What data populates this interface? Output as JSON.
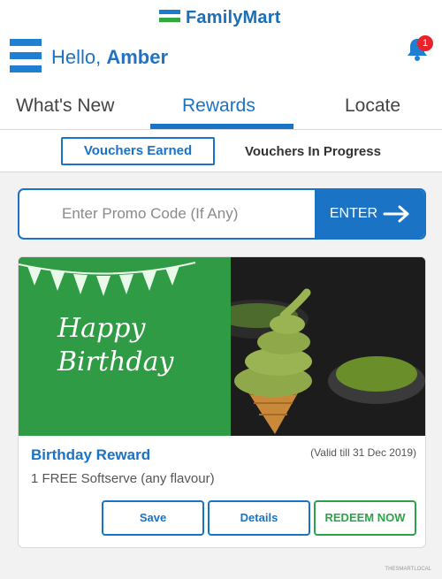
{
  "app": {
    "brand": "FamilyMart",
    "greeting_prefix": "Hello, ",
    "user_name": "Amber",
    "notification_count": "1"
  },
  "tabs": [
    {
      "label": "What's New"
    },
    {
      "label": "Rewards"
    },
    {
      "label": "Locate"
    }
  ],
  "subtabs": {
    "earned": "Vouchers Earned",
    "in_progress": "Vouchers In Progress"
  },
  "promo": {
    "placeholder": "Enter Promo Code (If Any)",
    "button_label": "ENTER"
  },
  "voucher": {
    "banner_line1": "Happy",
    "banner_line2": "Birthday",
    "title": "Birthday Reward",
    "validity": "(Valid till 31 Dec 2019)",
    "description": "1 FREE Softserve (any flavour)",
    "save_label": "Save",
    "details_label": "Details",
    "redeem_label": "REDEEM NOW"
  },
  "watermark": "THESMARTLOCAL",
  "colors": {
    "brand_blue": "#1a73c4",
    "brand_green": "#2eaa3f",
    "notification_red": "#e8232b",
    "redeem_green": "#2ea24a"
  },
  "icons": {
    "menu": "hamburger-icon",
    "notification": "bell-icon",
    "enter_arrow": "arrow-right-icon"
  }
}
